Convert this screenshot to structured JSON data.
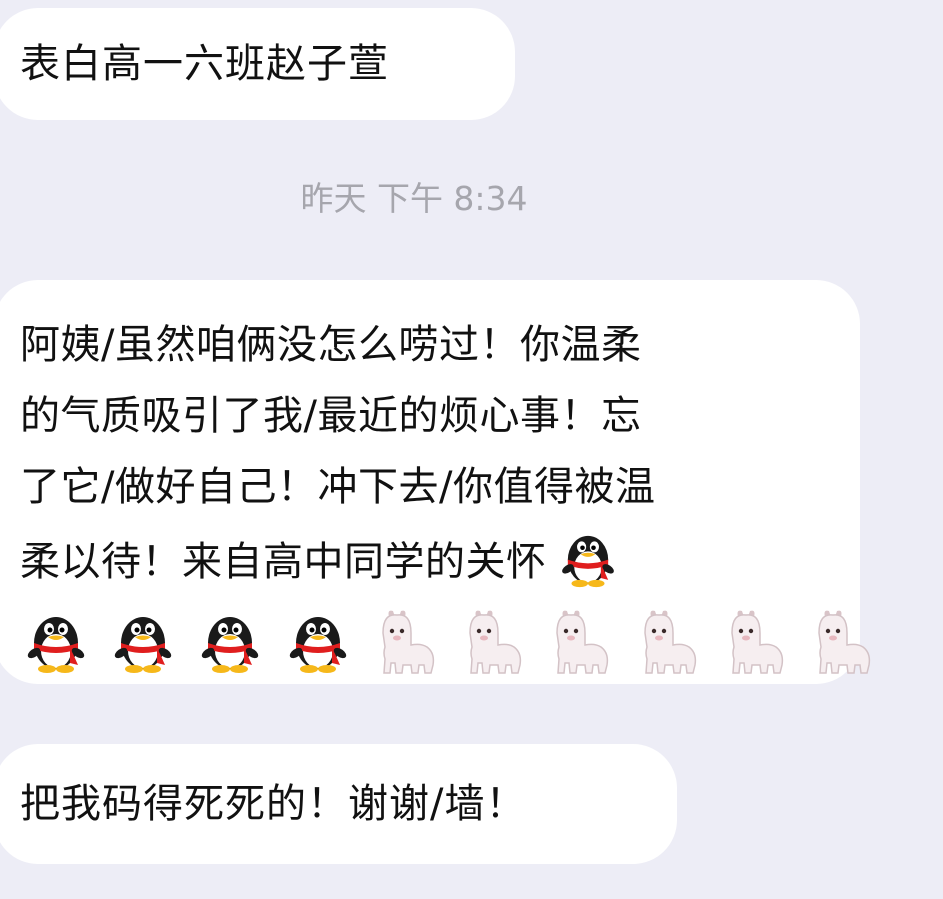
{
  "messages": [
    {
      "text": "表白高一六班赵子萱"
    },
    {
      "timestamp": "昨天 下午 8:34"
    },
    {
      "lines": [
        "阿姨/虽然咱俩没怎么唠过！你温柔",
        "的气质吸引了我/最近的烦心事！忘",
        "了它/做好自己！冲下去/你值得被温",
        "柔以待！来自高中同学的关怀"
      ],
      "trailing_emoji": "qq-penguin-icon",
      "emoji_row": [
        "qq-penguin-icon",
        "qq-penguin-icon",
        "qq-penguin-icon",
        "qq-penguin-icon",
        "alpaca-icon",
        "alpaca-icon",
        "alpaca-icon",
        "alpaca-icon",
        "alpaca-icon",
        "alpaca-icon"
      ]
    },
    {
      "text": "把我码得死死的！谢谢/墙！"
    }
  ],
  "colors": {
    "background": "#ededf6",
    "bubble": "#ffffff",
    "text": "#111111",
    "timestamp": "#a6a6ad",
    "penguin_body": "#1a1a1a",
    "penguin_scarf": "#e01e1e",
    "penguin_beak": "#f6b81a",
    "alpaca_body": "#f6eef0"
  }
}
